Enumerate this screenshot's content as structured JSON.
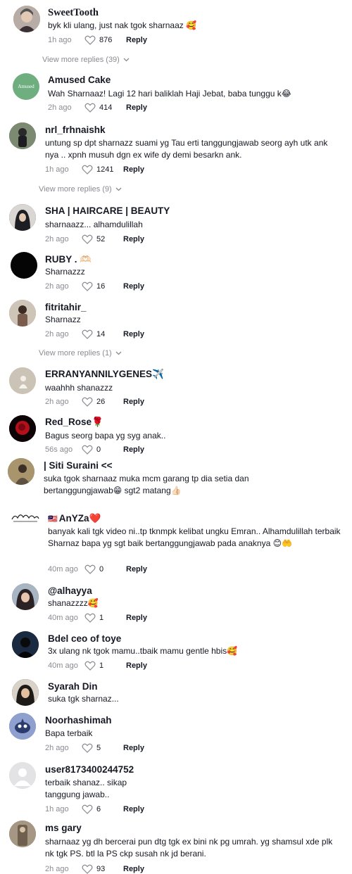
{
  "comments": [
    {
      "username": "SweetTooth",
      "text": "byk kli ulang, just nak tgok sharnaaz 🥰",
      "time": "1h ago",
      "likes": "876",
      "reply": "Reply",
      "avatar_color": "#9a8f8a"
    },
    {
      "username": "Amused Cake",
      "text": "Wah Sharnaaz! Lagi 12 hari baliklah Haji Jebat, baba tunggu k😂",
      "time": "2h ago",
      "likes": "414",
      "reply": "Reply",
      "avatar_text": "Amused",
      "avatar_color": "#6fae7f"
    },
    {
      "username": "nrl_frhnaishk",
      "text": "untung sp dpt sharnazz suami yg Tau erti tanggungjawab seorg ayh utk ank nya .. xpnh musuh dgn ex wife dy demi besarkn ank.",
      "time": "1h ago",
      "likes": "1241",
      "reply": "Reply",
      "avatar_color": "#5b5f57"
    },
    {
      "username": "SHA | HAIRCARE | BEAUTY",
      "text": "sharnaazz... alhamdulillah",
      "time": "2h ago",
      "likes": "52",
      "reply": "Reply",
      "avatar_color": "#2b2b33"
    },
    {
      "username": "RUBY . 🫶🏻",
      "text": "Sharnazzz",
      "time": "2h ago",
      "likes": "16",
      "reply": "Reply",
      "avatar_color": "#050505"
    },
    {
      "username": "fitritahir_",
      "text": "Sharnazz",
      "time": "2h ago",
      "likes": "14",
      "reply": "Reply",
      "avatar_color": "#8d7566"
    },
    {
      "username": "ERRANYANNILYGENES✈️",
      "text": "waahhh shanazzz",
      "time": "2h ago",
      "likes": "26",
      "reply": "Reply",
      "avatar_color": "#c9c2b7"
    },
    {
      "username": "Red_Rose🌹",
      "text": "Bagus seorg bapa yg syg anak..",
      "time": "56s ago",
      "likes": "0",
      "reply": "Reply",
      "avatar_color": "#1a0507"
    },
    {
      "username": "| Siti Suraini <<",
      "text": "suka tgok sharnaaz muka mcm garang tp dia setia dan bertanggungjawab😁 sgt2 matang👍🏻",
      "time": "",
      "likes": "",
      "reply": "",
      "avatar_color": "#8a7a5e"
    },
    {
      "username": "AnYZa❤️",
      "flag": "🇲🇾",
      "text": "banyak kali tgk video ni..tp tknmpk kelibat ungku Emran.. Alhamdulillah terbaik Sharnaz bapa yg sgt baik bertanggungjawab pada anaknya 😊🤲",
      "time": "40m ago",
      "likes": "0",
      "reply": "Reply",
      "avatar_color": "#ffffff"
    },
    {
      "username": "@alhayya",
      "text": "shanazzzz🥰",
      "time": "40m ago",
      "likes": "1",
      "reply": "Reply",
      "avatar_color": "#6b4f46"
    },
    {
      "username": "Bdel ceo of toye",
      "text": "3x ulang nk tgok mamu..tbaik mamu gentle hbis🥰",
      "time": "40m ago",
      "likes": "1",
      "reply": "Reply",
      "avatar_color": "#0d1a2a"
    },
    {
      "username": "Syarah Din",
      "text": "suka tgk sharnaz...",
      "time": "",
      "likes": "",
      "reply": "",
      "avatar_color": "#2e2a28"
    },
    {
      "username": "Noorhashimah",
      "text": "Bapa terbaik",
      "time": "2h ago",
      "likes": "5",
      "reply": "Reply",
      "avatar_color": "#6a7fb8"
    },
    {
      "username": "user8173400244752",
      "text": "terbaik shanaz.. sikap tanggung jawab..",
      "time": "1h ago",
      "likes": "6",
      "reply": "Reply",
      "avatar_color": "#d5d5d8"
    },
    {
      "username": "ms gary",
      "text": "sharnaaz yg dh bercerai pun dtg tgk ex bini nk pg umrah. yg shamsul xde plk nk tgk PS. btl la PS ckp susah nk jd berani.",
      "time": "2h ago",
      "likes": "93",
      "reply": "Reply",
      "avatar_color": "#8b7d6b"
    }
  ],
  "view_more": [
    {
      "label": "View more replies (39)"
    },
    {
      "label": "View more replies (9)"
    },
    {
      "label": "View more replies (1)"
    }
  ],
  "colors": {
    "text": "#161823",
    "muted": "#8a8b91"
  }
}
